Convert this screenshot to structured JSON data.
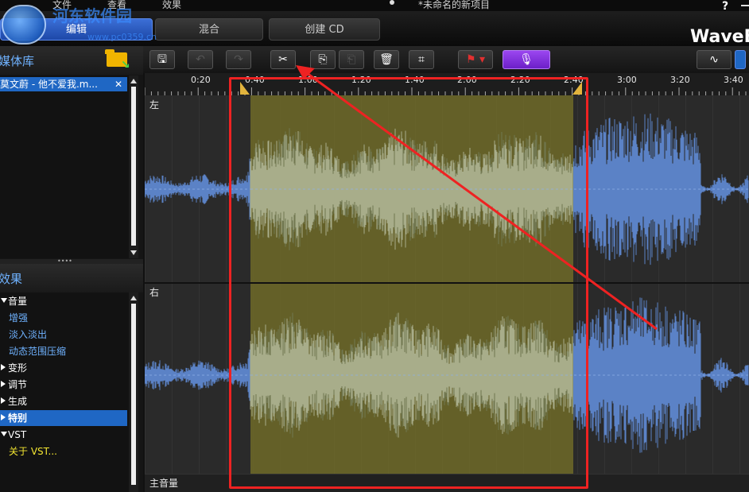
{
  "menu": {
    "file": "文件",
    "view": "查看",
    "effects": "效果"
  },
  "window": {
    "doc_title": "*未命名的新项目",
    "help": "?",
    "brand": "WaveEd"
  },
  "watermark": {
    "line1": "河东软件园",
    "line2": "www.pc0359.cn"
  },
  "tabs": {
    "edit": "编辑",
    "mix": "混合",
    "create_cd": "创建 CD"
  },
  "library": {
    "title": "媒体库",
    "item": "莫文蔚 - 他不爱我.m...",
    "close": "✕"
  },
  "effects_panel": {
    "title": "效果",
    "items": [
      {
        "label": "音量",
        "kind": "cat-open"
      },
      {
        "label": "增强",
        "kind": "sub"
      },
      {
        "label": "淡入淡出",
        "kind": "sub"
      },
      {
        "label": "动态范围压缩",
        "kind": "sub"
      },
      {
        "label": "变形",
        "kind": "cat-closed"
      },
      {
        "label": "调节",
        "kind": "cat-closed"
      },
      {
        "label": "生成",
        "kind": "cat-closed"
      },
      {
        "label": "特别",
        "kind": "cat-closed-selected"
      },
      {
        "label": "VST",
        "kind": "cat-open"
      },
      {
        "label": "关于 VST...",
        "kind": "yellow"
      }
    ]
  },
  "toolbar": [
    {
      "name": "save-button",
      "icon": "save-icon",
      "glyph": "🖫",
      "dim": false
    },
    {
      "name": "undo-button",
      "icon": "undo-icon",
      "glyph": "↶",
      "dim": true
    },
    {
      "name": "redo-button",
      "icon": "redo-icon",
      "glyph": "↷",
      "dim": true
    },
    {
      "name": "cut-button",
      "icon": "scissors-icon",
      "glyph": "✂",
      "dim": false
    },
    {
      "name": "copy-button",
      "icon": "copy-icon",
      "glyph": "⎘",
      "dim": false
    },
    {
      "name": "paste-button",
      "icon": "paste-icon",
      "glyph": "⎗",
      "dim": true
    },
    {
      "name": "delete-button",
      "icon": "trash-icon",
      "glyph": "🗑",
      "dim": false
    },
    {
      "name": "crop-button",
      "icon": "crop-icon",
      "glyph": "⌗",
      "dim": false
    }
  ],
  "timeline": {
    "ticks": [
      "0:20",
      "0:40",
      "1:00",
      "1:20",
      "1:40",
      "2:00",
      "2:20",
      "2:40",
      "3:00",
      "3:20",
      "3:40"
    ]
  },
  "channels": {
    "left": "左",
    "right": "右",
    "master": "主音量"
  },
  "colors": {
    "wave": "#5b82c6",
    "selection": "#7b782c",
    "accent": "#1f67c4",
    "annotation": "#ee2222"
  }
}
